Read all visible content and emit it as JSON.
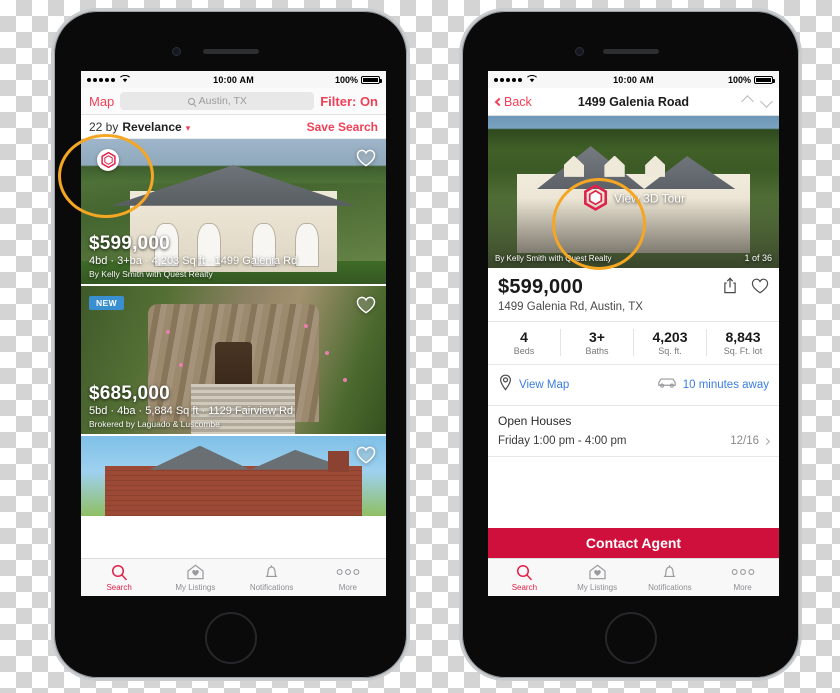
{
  "status_bar": {
    "time": "10:00 AM",
    "battery": "100%",
    "signal_dots": 5,
    "wifi_icon": "wifi-icon"
  },
  "left_phone": {
    "header": {
      "map_label": "Map",
      "search_placeholder": "Austin, TX",
      "search_icon": "search-icon",
      "filter_label": "Filter: On"
    },
    "sort_bar": {
      "count_prefix": "22 by",
      "sort_value": "Revelance",
      "caret_icon": "chevron-down-icon",
      "save_search_label": "Save Search"
    },
    "listings": [
      {
        "price": "$599,000",
        "specs": "4bd · 3+ba · 4,203 Sq ft · 1499 Galenia Rd",
        "broker": "By Kelly Smith with Quest Realty",
        "badge": "",
        "has_3d_tour": true,
        "favorite_icon": "heart-icon"
      },
      {
        "price": "$685,000",
        "specs": "5bd · 4ba · 5,884 Sq ft · 1129 Fairview Rd",
        "broker": "Brokered by Laguado & Luscombe",
        "badge": "NEW",
        "has_3d_tour": false,
        "favorite_icon": "heart-icon"
      },
      {
        "price": "",
        "specs": "",
        "broker": "",
        "badge": "",
        "has_3d_tour": false,
        "favorite_icon": "heart-icon"
      }
    ]
  },
  "right_phone": {
    "navbar": {
      "back_label": "Back",
      "back_icon": "chevron-left-icon",
      "title": "1499 Galenia Road",
      "prev_icon": "chevron-up-icon",
      "next_icon": "chevron-down-icon"
    },
    "hero": {
      "tour_label": "View 3D Tour",
      "tour_icon": "3d-cube-icon",
      "attribution": "By Kelly Smith with Quest Realty",
      "photo_counter": "1 of 36"
    },
    "detail": {
      "price": "$599,000",
      "address": "1499 Galenia Rd, Austin, TX",
      "share_icon": "share-icon",
      "favorite_icon": "heart-icon"
    },
    "stats": [
      {
        "value": "4",
        "label": "Beds"
      },
      {
        "value": "3+",
        "label": "Baths"
      },
      {
        "value": "4,203",
        "label": "Sq. ft."
      },
      {
        "value": "8,843",
        "label": "Sq. Ft. lot"
      }
    ],
    "map_row": {
      "view_map_label": "View Map",
      "map_pin_icon": "map-pin-icon",
      "commute_label": "10 minutes away",
      "car_icon": "car-icon"
    },
    "open_houses": {
      "title": "Open Houses",
      "schedule": "Friday 1:00 pm - 4:00 pm",
      "date": "12/16",
      "chevron_icon": "chevron-right-icon"
    },
    "contact_button": "Contact Agent"
  },
  "tab_bar": [
    {
      "label": "Search",
      "icon": "magnifier-icon",
      "active": true
    },
    {
      "label": "My Listings",
      "icon": "house-heart-icon",
      "active": false
    },
    {
      "label": "Notifications",
      "icon": "bell-icon",
      "active": false
    },
    {
      "label": "More",
      "icon": "ellipsis-icon",
      "active": false
    }
  ],
  "colors": {
    "brand_red": "#d0103c",
    "link_red": "#ef4056",
    "link_blue": "#3b7de0",
    "badge_blue": "#3a8fd1",
    "annotation_orange": "#f5a623"
  }
}
